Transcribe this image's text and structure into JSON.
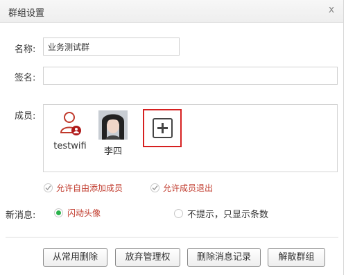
{
  "dialog": {
    "title": "群组设置",
    "close_glyph": "x"
  },
  "form": {
    "name_label": "名称:",
    "name_value": "业务测试群",
    "sign_label": "签名:",
    "sign_value": "",
    "members_label": "成员:"
  },
  "members": [
    {
      "name": "testwifi",
      "avatar": "user-outline-icon"
    },
    {
      "name": "李四",
      "avatar": "photo-avatar"
    }
  ],
  "add_member": {
    "icon": "plus-icon"
  },
  "options": {
    "allow_add": "允许自由添加成员",
    "allow_quit": "允许成员退出"
  },
  "new_message": {
    "label": "新消息:",
    "option1": "闪动头像",
    "option2": "不提示，只显示条数",
    "selected": "闪动头像"
  },
  "buttons": {
    "remove_common": "从常用删除",
    "give_up_admin": "放弃管理权",
    "delete_records": "删除消息记录",
    "disband": "解散群组"
  },
  "colors": {
    "accent_red": "#c0392b",
    "radio_green": "#2bb24c",
    "highlight": "#d62020"
  }
}
